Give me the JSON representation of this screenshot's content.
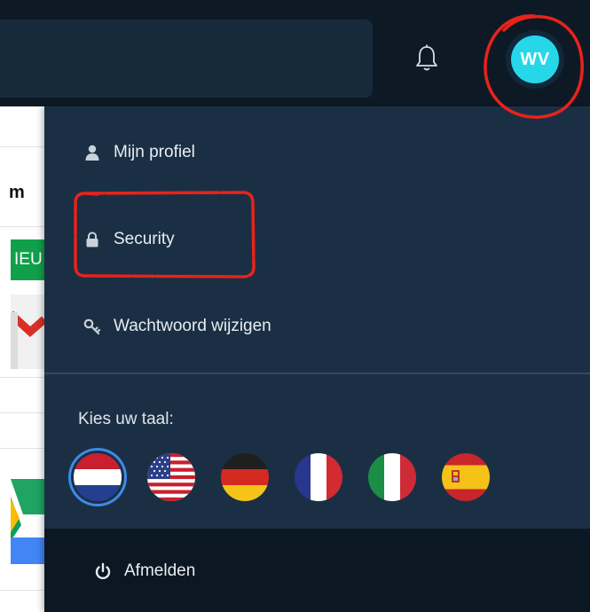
{
  "header": {
    "avatar_initials": "WV",
    "avatar_color": "#26d7ea",
    "icons": [
      "bell-icon"
    ]
  },
  "background_page": {
    "heading_fragment": "m",
    "badge_fragment": "IEU"
  },
  "user_menu": {
    "items": [
      {
        "label": "Mijn profiel",
        "icon": "person-icon"
      },
      {
        "label": "Security",
        "icon": "lock-icon"
      },
      {
        "label": "Wachtwoord wijzigen",
        "icon": "key-icon"
      }
    ],
    "language_label": "Kies uw taal:",
    "languages": [
      {
        "code": "nl",
        "flag": "netherlands-flag",
        "selected": true
      },
      {
        "code": "en",
        "flag": "usa-flag",
        "selected": false
      },
      {
        "code": "de",
        "flag": "germany-flag",
        "selected": false
      },
      {
        "code": "fr",
        "flag": "france-flag",
        "selected": false
      },
      {
        "code": "it",
        "flag": "italy-flag",
        "selected": false
      },
      {
        "code": "es",
        "flag": "spain-flag",
        "selected": false
      }
    ],
    "logout_label": "Afmelden"
  },
  "colors": {
    "menu_bg": "#1b2f44",
    "topbar_bg": "#0d1a26",
    "footer_bg": "#0b1722",
    "annotation_red": "#e8231a",
    "selected_ring": "#3e8ae8"
  }
}
